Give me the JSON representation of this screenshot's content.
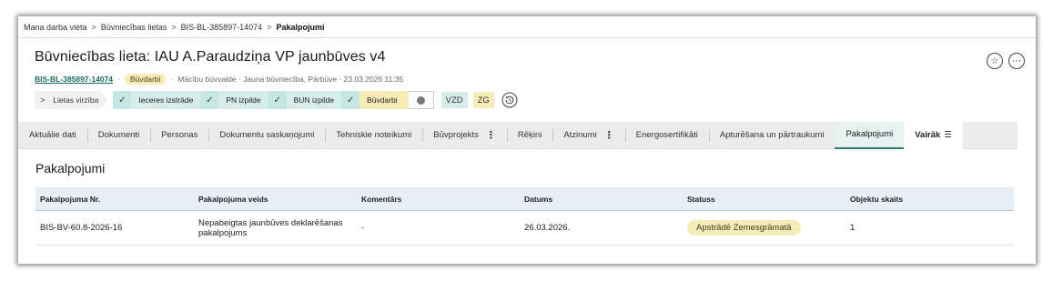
{
  "breadcrumb": {
    "items": [
      "Mana darba vieta",
      "Būvniecības lietas",
      "BIS-BL-385897-14074"
    ],
    "current": "Pakalpojumi"
  },
  "header": {
    "title": "Būvniecības lieta: IAU A.Paraudziņa VP jaunbūves v4",
    "case_number": "BIS-BL-385897-14074",
    "status_badge": "Būvdarbi",
    "meta_text": "Mācību būvvalde · Jauna būvniecība, Pārbūve · 23.03.2026 11:35",
    "favorite_icon": "☆",
    "more_icon": "⋯"
  },
  "process": {
    "toggle_label": "Lietas virzība",
    "steps": [
      "Ieceres izstrāde",
      "PN izpilde",
      "BUN izpilde",
      "Būvdarbi"
    ],
    "tag_vzd": "VZD",
    "tag_zg": "ZG"
  },
  "tabs": [
    "Aktuālie dati",
    "Dokumenti",
    "Personas",
    "Dokumentu saskaņojumi",
    "Tehniskie noteikumi",
    "Būvprojekts",
    "Rēķini",
    "Atzinumi",
    "Energosertifikāti",
    "Apturēšana un pārtraukumi",
    "Pakalpojumi"
  ],
  "more_label": "Vairāk",
  "section": {
    "title": "Pakalpojumi",
    "columns": [
      "Pakalpojuma Nr.",
      "Pakalpojuma veids",
      "Komentārs",
      "Datums",
      "Statuss",
      "Objektu skaits"
    ],
    "rows": [
      {
        "number": "BIS-BV-60.8-2026-16",
        "type": "Nepabeigtas jaunbūves deklarēšanas pakalpojums",
        "comment": "-",
        "date": "26.03.2026.",
        "status": "Apstrādē Zemesgrāmatā",
        "objects": "1"
      }
    ]
  },
  "colors": {
    "accent": "#2c7c6d",
    "step_done": "#d6ede9",
    "step_active": "#f7ecb5"
  }
}
